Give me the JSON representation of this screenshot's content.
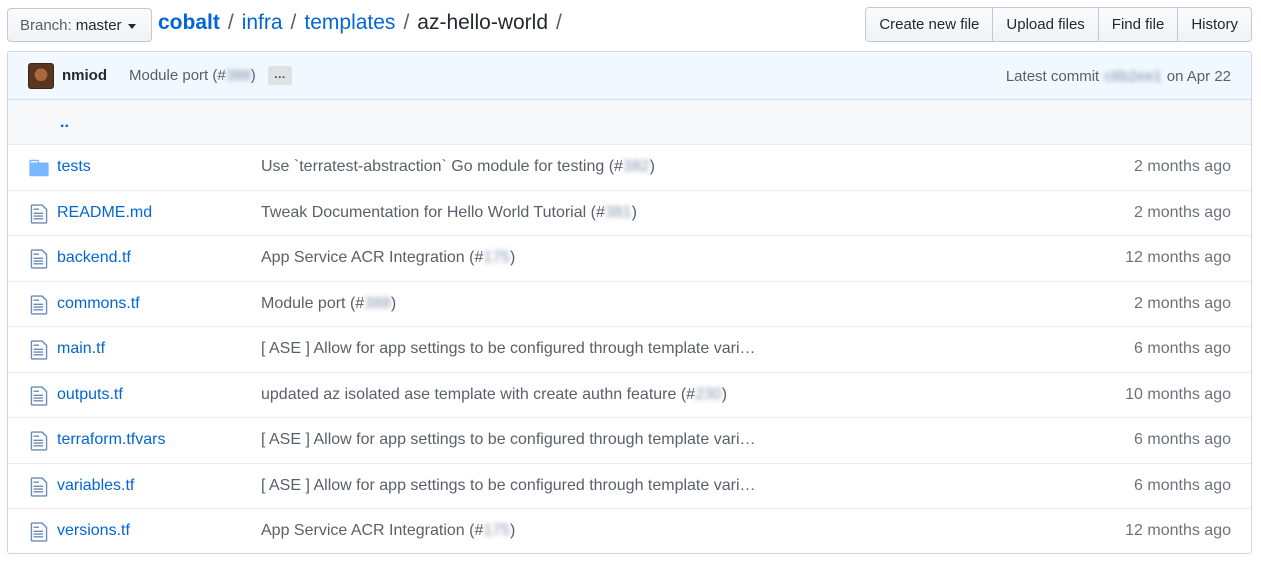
{
  "header": {
    "branch_label": "Branch:",
    "branch_value": "master",
    "breadcrumb": [
      "cobalt",
      "infra",
      "templates",
      "az-hello-world"
    ],
    "separator": "/",
    "buttons": [
      "Create new file",
      "Upload files",
      "Find file",
      "History"
    ]
  },
  "commit_bar": {
    "author": "nmiod",
    "message_prefix": "Module port (#",
    "message_pr": "388",
    "message_suffix": ")",
    "more_label": "…",
    "latest_label": "Latest commit",
    "sha": "c6b2ee1",
    "date": "on Apr 22"
  },
  "parent_dir": "..",
  "files": [
    {
      "type": "dir",
      "name": "tests",
      "msg": "Use `terratest-abstraction` Go module for testing (#",
      "pr": "382",
      "msg_end": ")",
      "age": "2 months ago"
    },
    {
      "type": "file",
      "name": "README.md",
      "msg": "Tweak Documentation for Hello World Tutorial (#",
      "pr": "381",
      "msg_end": ")",
      "age": "2 months ago"
    },
    {
      "type": "file",
      "name": "backend.tf",
      "msg": "App Service ACR Integration (#",
      "pr": "175",
      "msg_end": ")",
      "age": "12 months ago"
    },
    {
      "type": "file",
      "name": "commons.tf",
      "msg": "Module port (#",
      "pr": "388",
      "msg_end": ")",
      "age": "2 months ago"
    },
    {
      "type": "file",
      "name": "main.tf",
      "msg": "[ ASE ] Allow for app settings to be configured through template vari…",
      "pr": "",
      "msg_end": "",
      "age": "6 months ago"
    },
    {
      "type": "file",
      "name": "outputs.tf",
      "msg": "updated az isolated ase template with create authn feature (#",
      "pr": "230",
      "msg_end": ")",
      "age": "10 months ago"
    },
    {
      "type": "file",
      "name": "terraform.tfvars",
      "msg": "[ ASE ] Allow for app settings to be configured through template vari…",
      "pr": "",
      "msg_end": "",
      "age": "6 months ago"
    },
    {
      "type": "file",
      "name": "variables.tf",
      "msg": "[ ASE ] Allow for app settings to be configured through template vari…",
      "pr": "",
      "msg_end": "",
      "age": "6 months ago"
    },
    {
      "type": "file",
      "name": "versions.tf",
      "msg": "App Service ACR Integration (#",
      "pr": "175",
      "msg_end": ")",
      "age": "12 months ago"
    }
  ],
  "colors": {
    "link": "#0366d6",
    "folder": "#79b8ff",
    "commit_bar_bg": "#f1f8ff"
  }
}
